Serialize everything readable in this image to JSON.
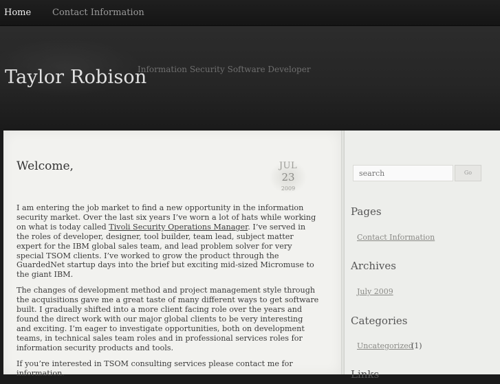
{
  "nav": {
    "home": "Home",
    "contact": "Contact Information"
  },
  "header": {
    "title": "Taylor Robison",
    "tagline": "Information Security Software Developer"
  },
  "post": {
    "title": "Welcome,",
    "date": {
      "month": "JUL",
      "day": "23",
      "year": "2009"
    },
    "p1_a": "I am entering the job market to find a new opportunity in the information security market.  Over the last six years I’ve worn a lot of hats while working on what is today called ",
    "p1_link": "Tivoli Security Operations Manager",
    "p1_b": ".  I’ve served in the roles of developer, designer, tool builder, team lead, subject matter expert for the IBM global sales  team, and lead problem solver for very special TSOM clients.  I’ve worked to grow the product through the GuardedNet startup days into the brief but exciting mid-sized Micromuse to the giant IBM.",
    "p2": "The changes of development method and project management style through the acquisitions gave me a great taste of many different ways to get software built.  I gradually shifted into a more client facing role over the years and found the direct work with our major global clients to be very interesting and exciting.  I’m eager to investigate opportunities, both on development teams, in technical sales team roles and in professional services roles for information security products and tools.",
    "p3": "If you’re interested in TSOM consulting services please contact me for information."
  },
  "sidebar": {
    "search_placeholder": "search",
    "search_button": "Go",
    "pages_title": "Pages",
    "pages_link": "Contact Information",
    "archives_title": "Archives",
    "archives_link": "July 2009",
    "categories_title": "Categories",
    "categories_link": "Uncategorized",
    "categories_count": "(1)",
    "links_title": "Links"
  }
}
